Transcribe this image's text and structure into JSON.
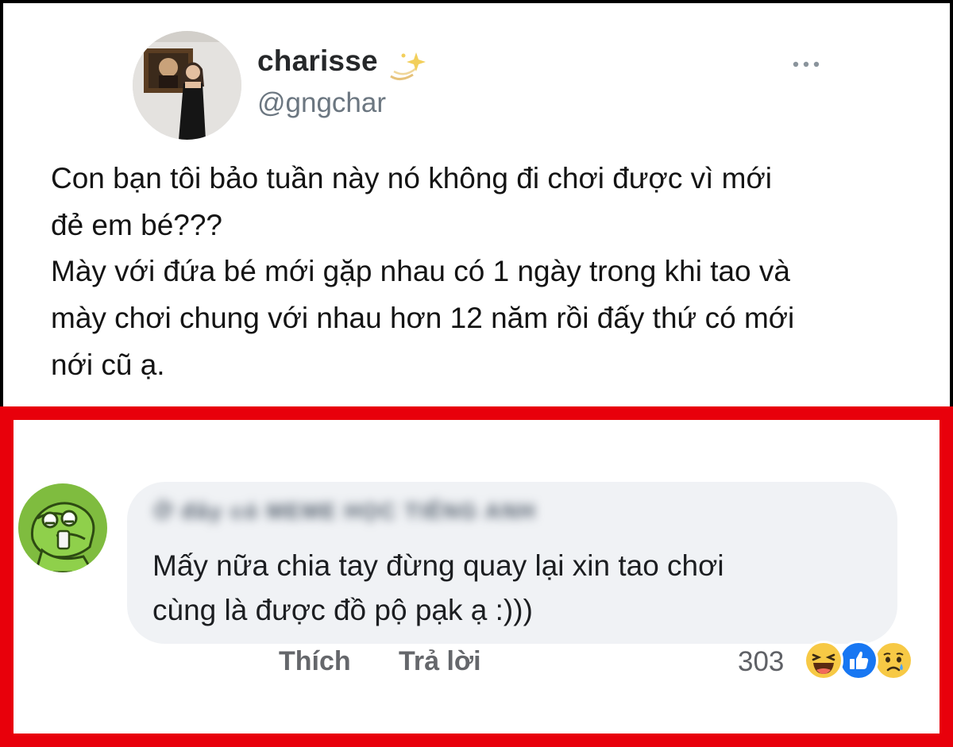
{
  "tweet": {
    "display_name": "charisse",
    "handle": "@gngchar",
    "verify_icon": "sparkle-icon",
    "menu_icon": "more-horizontal-icon",
    "text_lines": [
      "Con bạn tôi bảo tuần này nó không đi chơi được vì mới",
      "đẻ em bé???",
      "Mày với đứa bé mới gặp nhau có 1 ngày trong khi tao và",
      "mày chơi chung với nhau hơn 12 năm rồi đấy thứ có mới",
      "nới cũ ạ."
    ]
  },
  "comment": {
    "author_blurred": "Ở đây có MEME HỌC TIẾNG ANH",
    "text_lines": [
      "Mấy nữa chia tay đừng quay lại xin tao chơi",
      "cùng là được đồ pộ pạk ạ :)))"
    ],
    "like_label": "Thích",
    "reply_label": "Trả lời",
    "reaction_count": "303",
    "reactions": [
      "haha-icon",
      "like-icon",
      "sad-icon"
    ]
  },
  "colors": {
    "highlight_border": "#e8000b",
    "bubble_bg": "#f0f2f5",
    "like_blue": "#1877f2",
    "emoji_yellow": "#f7c945"
  }
}
